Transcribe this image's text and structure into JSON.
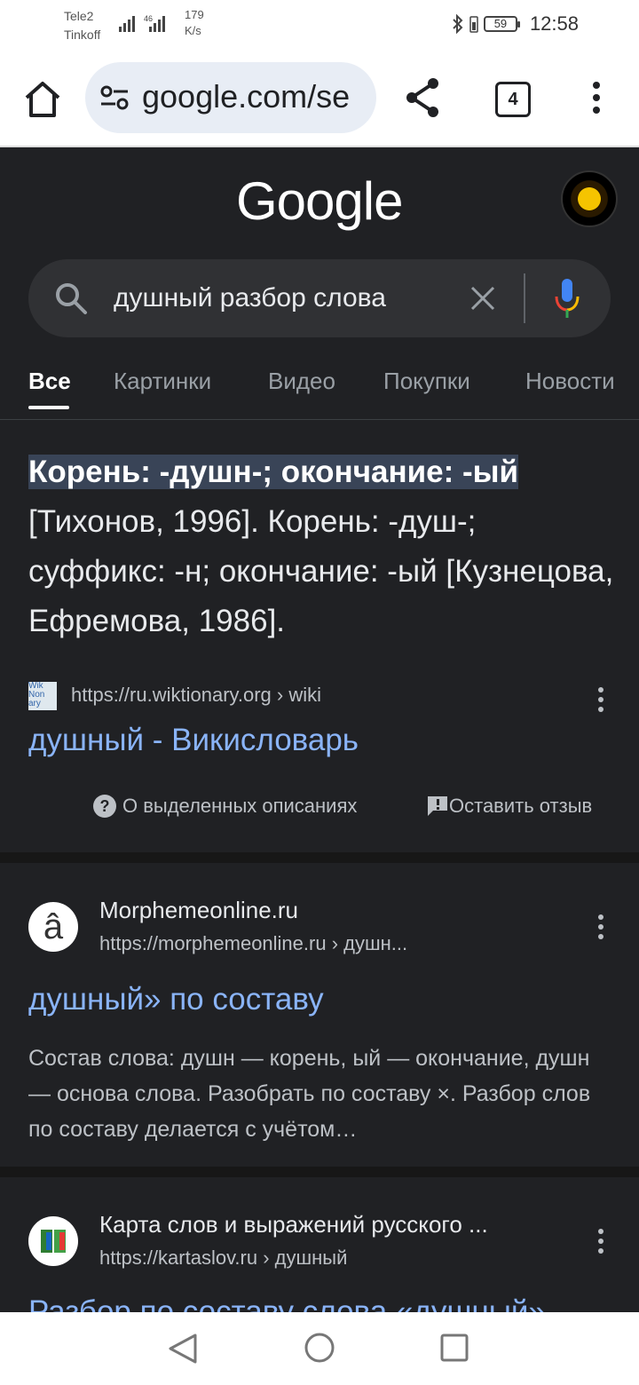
{
  "status_bar": {
    "carrier1": "Tele2",
    "carrier2": "Tinkoff",
    "net_label": "46",
    "speed_value": "179",
    "speed_unit": "K/s",
    "battery": "59",
    "time": "12:58"
  },
  "browser": {
    "url": "google.com/se",
    "tab_count": "4"
  },
  "google": {
    "logo": "Google",
    "search_query": "душный разбор слова"
  },
  "tabs": [
    {
      "label": "Все",
      "active": true
    },
    {
      "label": "Картинки"
    },
    {
      "label": "Видео"
    },
    {
      "label": "Покупки"
    },
    {
      "label": "Новости"
    }
  ],
  "featured": {
    "highlight": "Корень: -душн-; окончание: -ый",
    "text": " [Тихонов, 1996]. Корень: -душ-; суффикс: -н; окончание: -ый [Кузнецова, Ефремова, 1986].",
    "favicon_text": "Wik Non ary",
    "source_url": "https://ru.wiktionary.org › wiki",
    "title": "душный - Викисловарь",
    "about": "О выделенных описаниях",
    "feedback": "Оставить отзыв"
  },
  "results": [
    {
      "icon_char": "â",
      "site": "Morphemeonline.ru",
      "url": "https://morphemeonline.ru › душн...",
      "title": "душный» по составу",
      "description": "Состав слова: душн — корень, ый — окончание, душн — основа слова. Разобрать по составу ×. Разбор слов по составу делается с учётом…"
    },
    {
      "site": "Карта слов и выражений русского ...",
      "url": "https://kartaslov.ru › душный",
      "title": "Разбор по составу слова «душный»"
    }
  ],
  "colors": {
    "background": "#202124",
    "link": "#8ab4f8",
    "highlight": "#394457"
  }
}
